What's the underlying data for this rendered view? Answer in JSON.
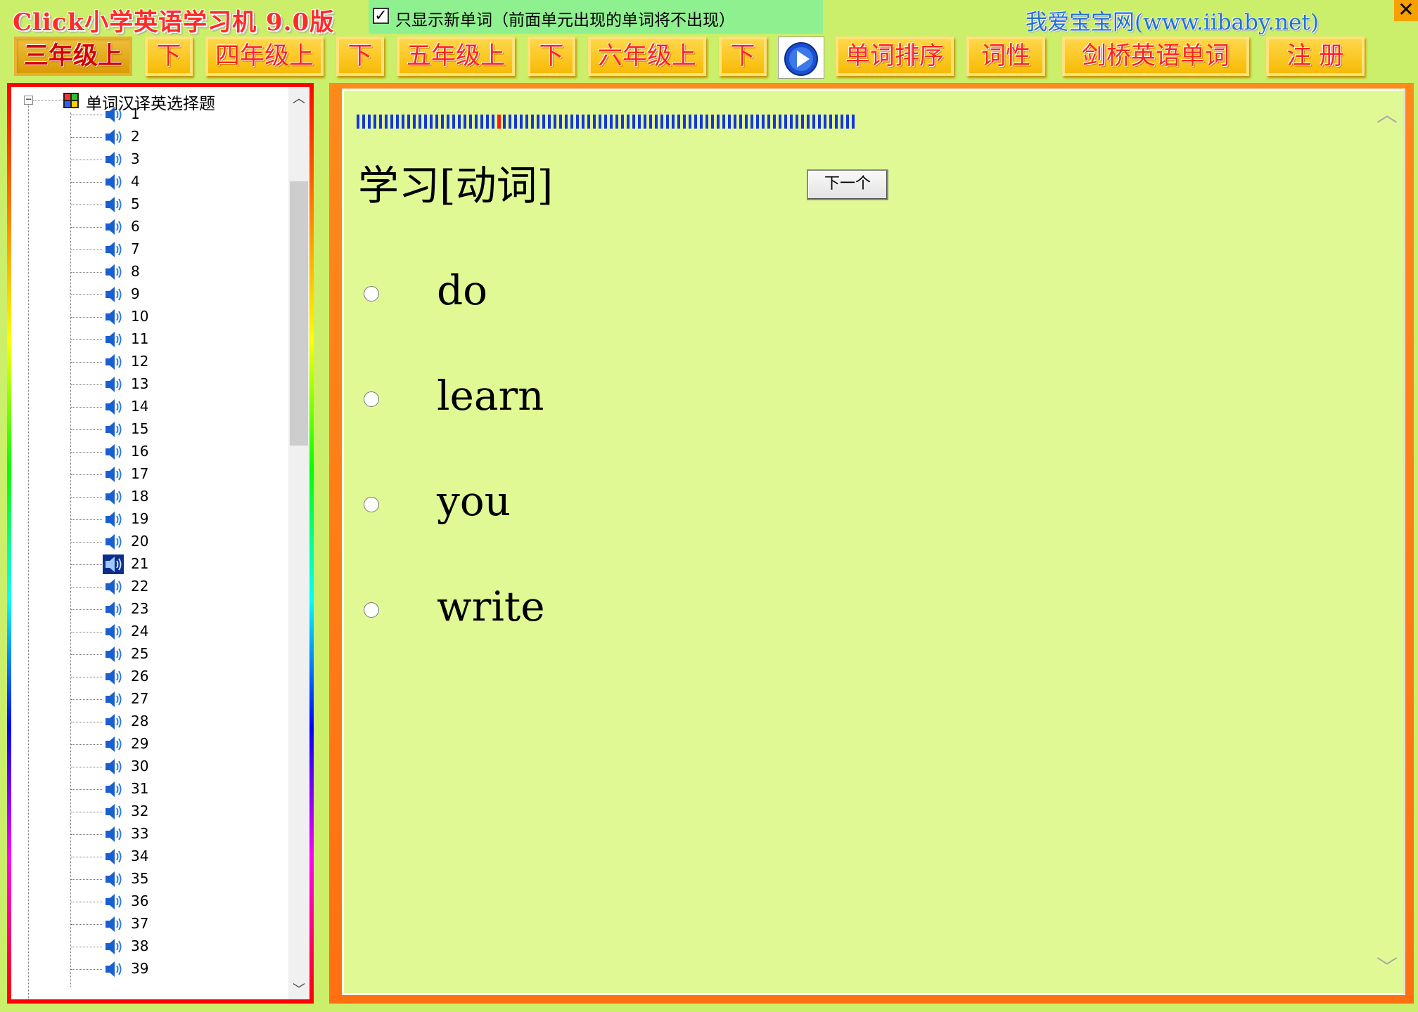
{
  "app": {
    "title": "Click小学英语学习机 9.0版",
    "site_link": "我爱宝宝网(www.iibaby.net)",
    "close_label": "✕"
  },
  "options": {
    "new_words_only_checked": true,
    "new_words_only_label": "只显示新单词（前面单元出现的单词将不出现）"
  },
  "toolbar": {
    "grade3_upper": "三年级上",
    "grade3_lower": "下",
    "grade4_upper": "四年级上",
    "grade4_lower": "下",
    "grade5_upper": "五年级上",
    "grade5_lower": "下",
    "grade6_upper": "六年级上",
    "grade6_lower": "下",
    "play_icon": "play-icon",
    "word_sort": "单词排序",
    "part_of_speech": "词性",
    "cambridge_words": "剑桥英语单词",
    "register": "注 册"
  },
  "tree": {
    "root_label": "单词汉译英选择题",
    "root_icon": "grid-icon",
    "item_icon": "speaker-icon",
    "selected_index": 21,
    "items": [
      "1",
      "2",
      "3",
      "4",
      "5",
      "6",
      "7",
      "8",
      "9",
      "10",
      "11",
      "12",
      "13",
      "14",
      "15",
      "16",
      "17",
      "18",
      "19",
      "20",
      "21",
      "22",
      "23",
      "24",
      "25",
      "26",
      "27",
      "28",
      "29",
      "30",
      "31",
      "32",
      "33",
      "34",
      "35",
      "36",
      "37",
      "38",
      "39"
    ]
  },
  "quiz": {
    "progress_current": 39,
    "progress_total": 138,
    "question": "学习[动词]",
    "next_label": "下一个",
    "choices": [
      "do",
      "learn",
      "you",
      "write"
    ],
    "selected_choice": null
  },
  "colors": {
    "background": "#cbef6a",
    "quiz_area": "#e1f995",
    "toolbar_button": "#f7b800",
    "button_text": "#ff2020",
    "progress": "#1438d8",
    "progress_marker": "#ff1a1a",
    "tree_selected": "#0b2f8a"
  }
}
